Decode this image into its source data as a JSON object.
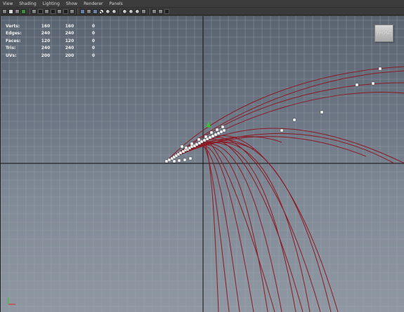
{
  "window": {
    "menus": [
      "View",
      "Shading",
      "Lighting",
      "Show",
      "Renderer",
      "Panels"
    ]
  },
  "toolbar": {
    "icons": [
      "camera-select-icon",
      "camera-attributes-icon",
      "bookmark-icon",
      "image-plane-icon",
      "grid-toggle-icon",
      "film-gate-icon",
      "resolution-gate-icon",
      "gate-mask-icon",
      "field-chart-icon",
      "safe-action-icon",
      "safe-title-icon",
      "wireframe-icon",
      "smooth-shade-icon",
      "flat-shade-icon",
      "bounding-box-icon",
      "textured-icon",
      "use-lights-icon",
      "shadows-icon",
      "isolate-select-icon",
      "xray-icon",
      "xray-joints-icon",
      "backface-icon",
      "hud-toggle-icon",
      "layout-icon",
      "close-icon"
    ]
  },
  "hud": {
    "rows": [
      {
        "label": "Verts:",
        "values": [
          "160",
          "160",
          "0"
        ]
      },
      {
        "label": "Edges:",
        "values": [
          "240",
          "240",
          "0"
        ]
      },
      {
        "label": "Faces:",
        "values": [
          "120",
          "120",
          "0"
        ]
      },
      {
        "label": "Tris:",
        "values": [
          "240",
          "240",
          "0"
        ]
      },
      {
        "label": "UVs:",
        "values": [
          "200",
          "200",
          "0"
        ]
      }
    ]
  },
  "viewcube": {
    "label": "FRONT"
  },
  "colors": {
    "curve": "#8c1a24",
    "grid": "#a7afb8",
    "axis": "#111111",
    "gizmo_x": "#d23a3a",
    "gizmo_y": "#37c237"
  }
}
